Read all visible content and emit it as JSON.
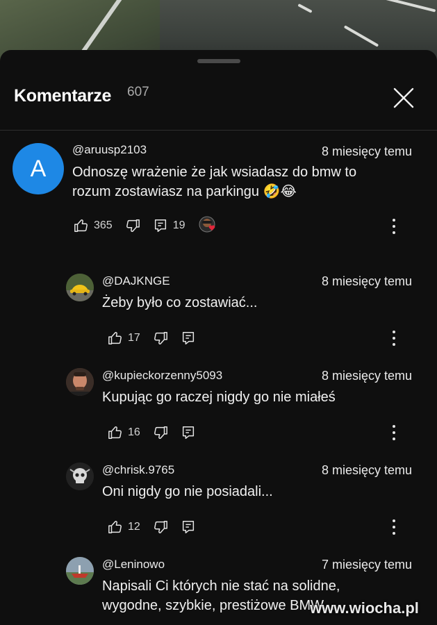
{
  "header": {
    "title": "Komentarze",
    "count": "607"
  },
  "icons": {
    "close": "close-icon",
    "like": "thumb-up-icon",
    "dislike": "thumb-down-icon",
    "reply": "reply-icon",
    "more": "more-vertical-icon"
  },
  "comments": [
    {
      "author": "@aruusp2103",
      "time": "8 miesięcy temu",
      "text": "Odnoszę wrażenie że jak wsiadasz do bmw to rozum zostawiasz na parkingu 🤣😂",
      "likes": "365",
      "replies": "19",
      "avatar_letter": "A",
      "avatar_color": "#1e88e5"
    },
    {
      "author": "@DAJKNGE",
      "time": "8 miesięcy temu",
      "text": "Żeby było co zostawiać...",
      "likes": "17"
    },
    {
      "author": "@kupieckorzenny5093",
      "time": "8 miesięcy temu",
      "text": "Kupując go raczej nigdy go nie miałeś",
      "likes": "16"
    },
    {
      "author": "@chrisk.9765",
      "time": "8 miesięcy temu",
      "text": "Oni nigdy go nie posiadali...",
      "likes": "12"
    },
    {
      "author": "@Leninowo",
      "time": "7 miesięcy temu",
      "text": "Napisali Ci których nie stać na solidne, wygodne, szybkie, prestiżowe  BMW..."
    }
  ],
  "watermark": "www.wiocha.pl"
}
